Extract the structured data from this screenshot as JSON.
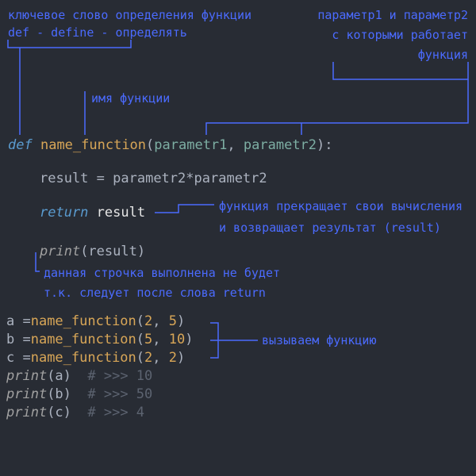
{
  "annotations": {
    "def_keyword_line1": "ключевое слово определения функции",
    "def_keyword_line2": "def - define - определять",
    "params_line1": "параметр1 и параметр2",
    "params_line2": "с которыми работает",
    "params_line3": "функция",
    "func_name": "имя функции",
    "return_line1": "функция прекращает свои вычисления",
    "return_line2": "и возвращает результат (result)",
    "print_dead_line1": "данная строчка выполнена не будет",
    "print_dead_line2": "т.к. следует после слова return",
    "call_func": "вызываем функцию"
  },
  "code": {
    "def": "def",
    "fname": "name_function",
    "open": "(",
    "p1": "parametr1",
    "comma": ",",
    "p2": "parametr2",
    "close": ")",
    "colon": ":",
    "result_assign": "result = parametr2*parametr2",
    "result_var": "result",
    "eq": " = ",
    "star": "*",
    "return_kw": "return",
    "return_val": " result",
    "print_kw": "print",
    "print_arg": "(result)",
    "call_a": "a =",
    "call_b": "b =",
    "call_c": "c =",
    "args_a": "(2, 5)",
    "args_b": "(5, 10)",
    "args_c": "(2, 2)",
    "n2": "2",
    "n5": "5",
    "n10": "10",
    "print_a": "(a)",
    "print_b": "(b)",
    "print_c": "(c)",
    "comment_a": "  # >>> 10",
    "comment_b": "  # >>> 50",
    "comment_c": "  # >>> 4"
  }
}
